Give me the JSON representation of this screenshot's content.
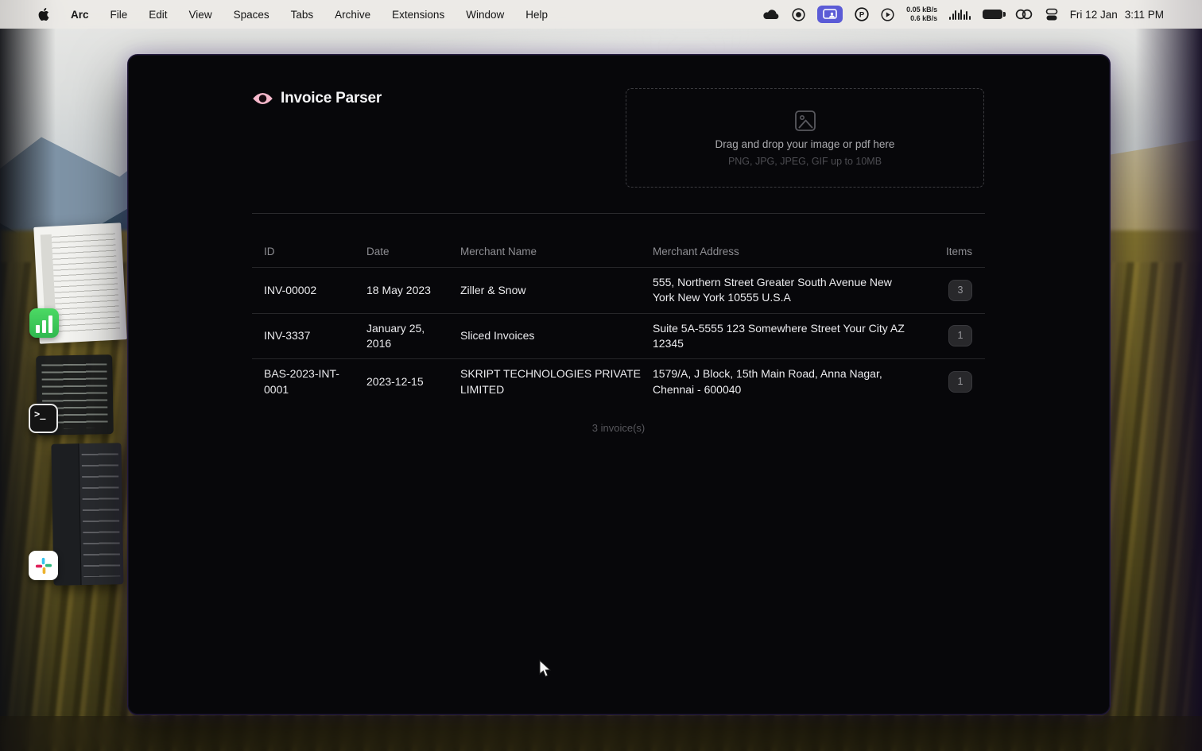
{
  "menubar": {
    "items": [
      "Arc",
      "File",
      "Edit",
      "View",
      "Spaces",
      "Tabs",
      "Archive",
      "Extensions",
      "Window",
      "Help"
    ],
    "status": {
      "network_up": "0.05 kB/s",
      "network_down": "0.6 kB/s",
      "date": "Fri 12 Jan",
      "time": "3:11 PM"
    }
  },
  "app": {
    "title": "Invoice Parser",
    "dropzone": {
      "line1": "Drag and drop your image or pdf here",
      "line2": "PNG, JPG, JPEG, GIF up to 10MB"
    },
    "table": {
      "headers": {
        "id": "ID",
        "date": "Date",
        "merchant_name": "Merchant Name",
        "merchant_address": "Merchant Address",
        "items": "Items"
      },
      "rows": [
        {
          "id": "INV-00002",
          "date": "18 May 2023",
          "merchant_name": "Ziller & Snow",
          "merchant_address": "555, Northern Street Greater South Avenue New York New York 10555 U.S.A",
          "items": "3"
        },
        {
          "id": "INV-3337",
          "date": "January 25, 2016",
          "merchant_name": "Sliced Invoices",
          "merchant_address": "Suite 5A-5555 123 Somewhere Street Your City AZ 12345",
          "items": "1"
        },
        {
          "id": "BAS-2023-INT-0001",
          "date": "2023-12-15",
          "merchant_name": "SKRIPT TECHNOLOGIES PRIVATE LIMITED",
          "merchant_address": "1579/A, J Block, 15th Main Road, Anna Nagar, Chennai - 600040",
          "items": "1"
        }
      ],
      "footer": "3 invoice(s)"
    }
  },
  "colors": {
    "accent_purple": "#5b5bd6",
    "logo_pink": "#f5b8cb",
    "window_bg": "#07070a",
    "badge_bg": "#28282b"
  }
}
